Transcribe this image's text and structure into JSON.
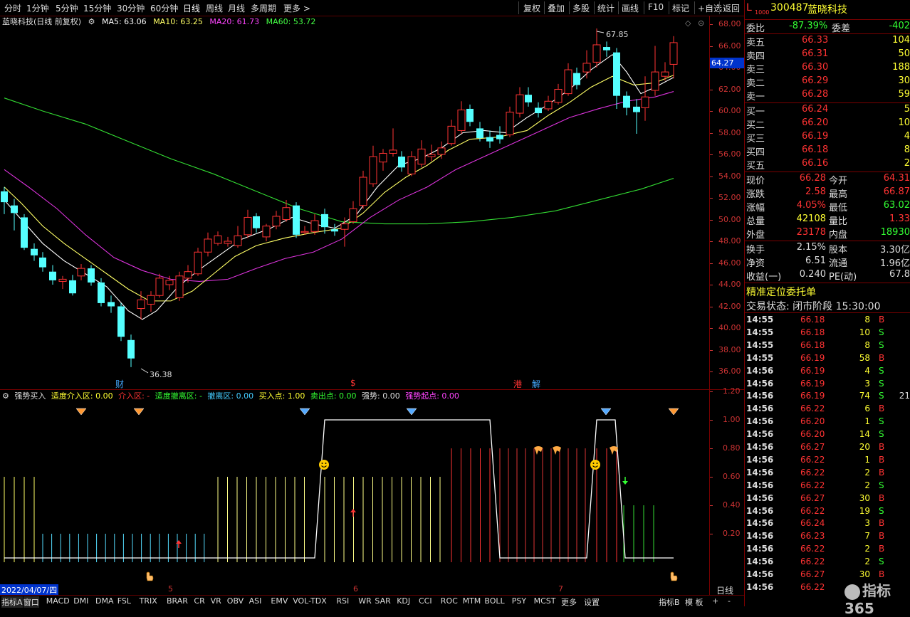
{
  "topbar": {
    "timeframes": [
      "分时",
      "1分钟",
      "5分钟",
      "15分钟",
      "30分钟",
      "60分钟",
      "日线",
      "周线",
      "月线",
      "多周期",
      "更多 >"
    ],
    "active_timeframe": "日线",
    "right_buttons": [
      "复权",
      "叠加",
      "多股",
      "统计",
      "画线",
      "F10",
      "标记",
      "+自选",
      "返回"
    ]
  },
  "main_chart": {
    "title": "蓝晓科技(日线 前复权)",
    "ma": [
      {
        "label": "MA5: 63.06",
        "color": "#ffffff"
      },
      {
        "label": "MA10: 63.25",
        "color": "#ffff66"
      },
      {
        "label": "MA20: 61.73",
        "color": "#ff44ff"
      },
      {
        "label": "MA60: 53.72",
        "color": "#44ff44"
      }
    ],
    "current_price_tag": "64.27",
    "high_label": "67.85",
    "low_label": "36.38",
    "markers": [
      {
        "text": "财",
        "color": "#4af"
      },
      {
        "text": "$",
        "color": "#f33"
      },
      {
        "text": "港",
        "color": "#f33"
      },
      {
        "text": "解",
        "color": "#4af"
      }
    ],
    "y_axis": [
      "68.00",
      "66.00",
      "64.00",
      "62.00",
      "60.00",
      "58.00",
      "56.00",
      "54.00",
      "52.00",
      "50.00",
      "48.00",
      "46.00",
      "44.00",
      "42.00",
      "40.00",
      "38.00",
      "36.00"
    ]
  },
  "indicator": {
    "name": "强势买入",
    "fields": [
      {
        "label": "适度介入区: 0.00",
        "color": "#ff3"
      },
      {
        "label": "介入区: -",
        "color": "#f33"
      },
      {
        "label": "适度撤离区: -",
        "color": "#3f3"
      },
      {
        "label": "撤离区: 0.00",
        "color": "#4cf"
      },
      {
        "label": "买入点: 1.00",
        "color": "#ff3"
      },
      {
        "label": "卖出点: 0.00",
        "color": "#3f3"
      },
      {
        "label": "强势: 0.00",
        "color": "#ddd"
      },
      {
        "label": "强势起点: 0.00",
        "color": "#f4f"
      }
    ],
    "y_axis": [
      "1.20",
      "1.00",
      "0.80",
      "0.60",
      "0.40",
      "0.20"
    ]
  },
  "datebar": {
    "date": "2022/04/07/四",
    "months": [
      "5",
      "6",
      "7"
    ],
    "period": "日线"
  },
  "bottombar": {
    "tabs": [
      "指标A",
      "窗口",
      "MACD",
      "DMI",
      "DMA",
      "FSL",
      "TRIX",
      "BRAR",
      "CR",
      "VR",
      "OBV",
      "ASI",
      "EMV",
      "VOL-TDX",
      "RSI",
      "WR",
      "SAR",
      "KDJ",
      "CCI",
      "ROC",
      "MTM",
      "BOLL",
      "PSY",
      "MCST",
      "更多",
      "设置"
    ],
    "right": [
      "指标B",
      "模 板",
      "+",
      "-"
    ]
  },
  "right_panel": {
    "code": "300487",
    "name": "蓝晓科技",
    "tag": "L",
    "weibi_label": "委比",
    "weibi": "-87.39%",
    "weicha_label": "委差",
    "weicha": "-402",
    "asks": [
      {
        "label": "卖五",
        "price": "66.33",
        "vol": "104"
      },
      {
        "label": "卖四",
        "price": "66.31",
        "vol": "50"
      },
      {
        "label": "卖三",
        "price": "66.30",
        "vol": "188"
      },
      {
        "label": "卖二",
        "price": "66.29",
        "vol": "30"
      },
      {
        "label": "卖一",
        "price": "66.28",
        "vol": "59"
      }
    ],
    "bids": [
      {
        "label": "买一",
        "price": "66.24",
        "vol": "5"
      },
      {
        "label": "买二",
        "price": "66.20",
        "vol": "10"
      },
      {
        "label": "买三",
        "price": "66.19",
        "vol": "4"
      },
      {
        "label": "买四",
        "price": "66.18",
        "vol": "8"
      },
      {
        "label": "买五",
        "price": "66.16",
        "vol": "2"
      }
    ],
    "stats": [
      {
        "l1": "现价",
        "v1": "66.28",
        "c1": "red",
        "l2": "今开",
        "v2": "64.31",
        "c2": "red"
      },
      {
        "l1": "涨跌",
        "v1": "2.58",
        "c1": "red",
        "l2": "最高",
        "v2": "66.87",
        "c2": "red"
      },
      {
        "l1": "涨幅",
        "v1": "4.05%",
        "c1": "red",
        "l2": "最低",
        "v2": "63.02",
        "c2": "green"
      },
      {
        "l1": "总量",
        "v1": "42108",
        "c1": "yellow",
        "l2": "量比",
        "v2": "1.33",
        "c2": "red"
      },
      {
        "l1": "外盘",
        "v1": "23178",
        "c1": "red",
        "l2": "内盘",
        "v2": "18930",
        "c2": "green"
      }
    ],
    "stats2": [
      {
        "l1": "换手",
        "v1": "2.15%",
        "l2": "股本",
        "v2": "3.30亿"
      },
      {
        "l1": "净资",
        "v1": "6.51",
        "l2": "流通",
        "v2": "1.96亿"
      },
      {
        "l1": "收益(一)",
        "v1": "0.240",
        "l2": "PE(动)",
        "v2": "67.8"
      }
    ],
    "order_title": "精准定位委托单",
    "trade_status": "交易状态: 闭市阶段 15:30:00",
    "ticks": [
      {
        "t": "14:55",
        "p": "66.18",
        "v": "8",
        "d": "B"
      },
      {
        "t": "14:55",
        "p": "66.18",
        "v": "10",
        "d": "S"
      },
      {
        "t": "14:55",
        "p": "66.18",
        "v": "8",
        "d": "S"
      },
      {
        "t": "14:55",
        "p": "66.19",
        "v": "58",
        "d": "B"
      },
      {
        "t": "14:56",
        "p": "66.19",
        "v": "4",
        "d": "S"
      },
      {
        "t": "14:56",
        "p": "66.19",
        "v": "3",
        "d": "S"
      },
      {
        "t": "14:56",
        "p": "66.19",
        "v": "74",
        "d": "S",
        "x": "21"
      },
      {
        "t": "14:56",
        "p": "66.22",
        "v": "6",
        "d": "B"
      },
      {
        "t": "14:56",
        "p": "66.20",
        "v": "1",
        "d": "S"
      },
      {
        "t": "14:56",
        "p": "66.20",
        "v": "14",
        "d": "S"
      },
      {
        "t": "14:56",
        "p": "66.27",
        "v": "20",
        "d": "B"
      },
      {
        "t": "14:56",
        "p": "66.22",
        "v": "1",
        "d": "B"
      },
      {
        "t": "14:56",
        "p": "66.22",
        "v": "2",
        "d": "B"
      },
      {
        "t": "14:56",
        "p": "66.22",
        "v": "2",
        "d": "S"
      },
      {
        "t": "14:56",
        "p": "66.27",
        "v": "30",
        "d": "B"
      },
      {
        "t": "14:56",
        "p": "66.22",
        "v": "19",
        "d": "S"
      },
      {
        "t": "14:56",
        "p": "66.24",
        "v": "3",
        "d": "B"
      },
      {
        "t": "14:56",
        "p": "66.23",
        "v": "7",
        "d": "B"
      },
      {
        "t": "14:56",
        "p": "66.22",
        "v": "2",
        "d": "B"
      },
      {
        "t": "14:56",
        "p": "66.22",
        "v": "2",
        "d": "S"
      },
      {
        "t": "14:56",
        "p": "66.27",
        "v": "30",
        "d": "B"
      },
      {
        "t": "14:56",
        "p": "66.22",
        "v": "",
        "d": ""
      }
    ],
    "watermark": "指标365"
  },
  "colors": {
    "up": "#ff3333",
    "down": "#55ffff",
    "axis": "#cc3333",
    "border": "#7a0000"
  }
}
